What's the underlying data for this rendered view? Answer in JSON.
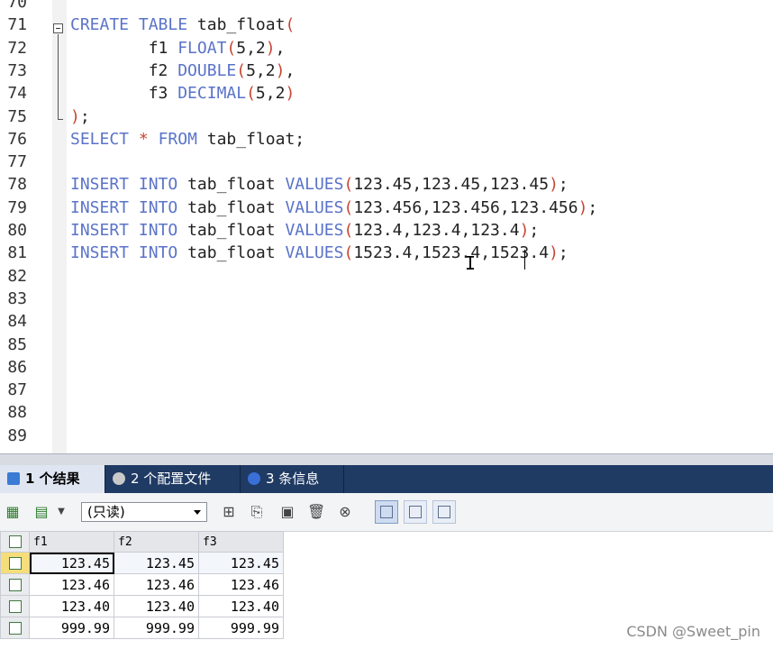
{
  "editor": {
    "lines": [
      {
        "n": "70",
        "code": []
      },
      {
        "n": "71",
        "code": [
          [
            "kw",
            "CREATE"
          ],
          [
            "t",
            " "
          ],
          [
            "kw",
            "TABLE"
          ],
          [
            "t",
            " tab_float"
          ],
          [
            "par",
            "("
          ]
        ]
      },
      {
        "n": "72",
        "code": [
          [
            "t",
            "        f1 "
          ],
          [
            "kw",
            "FLOAT"
          ],
          [
            "par",
            "("
          ],
          [
            "t",
            "5,2"
          ],
          [
            "par",
            ")"
          ],
          [
            "t",
            ","
          ]
        ]
      },
      {
        "n": "73",
        "code": [
          [
            "t",
            "        f2 "
          ],
          [
            "kw",
            "DOUBLE"
          ],
          [
            "par",
            "("
          ],
          [
            "t",
            "5,2"
          ],
          [
            "par",
            ")"
          ],
          [
            "t",
            ","
          ]
        ]
      },
      {
        "n": "74",
        "code": [
          [
            "t",
            "        f3 "
          ],
          [
            "kw",
            "DECIMAL"
          ],
          [
            "par",
            "("
          ],
          [
            "t",
            "5,2"
          ],
          [
            "par",
            ")"
          ]
        ]
      },
      {
        "n": "75",
        "code": [
          [
            "par",
            ")"
          ],
          [
            "t",
            ";"
          ]
        ]
      },
      {
        "n": "76",
        "code": [
          [
            "kw",
            "SELECT"
          ],
          [
            "t",
            " "
          ],
          [
            "par",
            "*"
          ],
          [
            "t",
            " "
          ],
          [
            "kw",
            "FROM"
          ],
          [
            "t",
            " tab_float;"
          ]
        ]
      },
      {
        "n": "77",
        "code": []
      },
      {
        "n": "78",
        "code": [
          [
            "kw",
            "INSERT"
          ],
          [
            "t",
            " "
          ],
          [
            "kw",
            "INTO"
          ],
          [
            "t",
            " tab_float "
          ],
          [
            "kw",
            "VALUES"
          ],
          [
            "par",
            "("
          ],
          [
            "t",
            "123.45,123.45,123.45"
          ],
          [
            "par",
            ")"
          ],
          [
            "t",
            ";"
          ]
        ]
      },
      {
        "n": "79",
        "code": [
          [
            "kw",
            "INSERT"
          ],
          [
            "t",
            " "
          ],
          [
            "kw",
            "INTO"
          ],
          [
            "t",
            " tab_float "
          ],
          [
            "kw",
            "VALUES"
          ],
          [
            "par",
            "("
          ],
          [
            "t",
            "123.456,123.456,123.456"
          ],
          [
            "par",
            ")"
          ],
          [
            "t",
            ";"
          ]
        ]
      },
      {
        "n": "80",
        "code": [
          [
            "kw",
            "INSERT"
          ],
          [
            "t",
            " "
          ],
          [
            "kw",
            "INTO"
          ],
          [
            "t",
            " tab_float "
          ],
          [
            "kw",
            "VALUES"
          ],
          [
            "par",
            "("
          ],
          [
            "t",
            "123.4,123.4,123.4"
          ],
          [
            "par",
            ")"
          ],
          [
            "t",
            ";"
          ]
        ]
      },
      {
        "n": "81",
        "code": [
          [
            "kw",
            "INSERT"
          ],
          [
            "t",
            " "
          ],
          [
            "kw",
            "INTO"
          ],
          [
            "t",
            " tab_float "
          ],
          [
            "kw",
            "VALUES"
          ],
          [
            "par",
            "("
          ],
          [
            "t",
            "1523.4,1523.4,1523.4"
          ],
          [
            "par",
            ")"
          ],
          [
            "t",
            ";"
          ]
        ]
      },
      {
        "n": "82",
        "code": []
      },
      {
        "n": "83",
        "code": []
      },
      {
        "n": "84",
        "code": []
      },
      {
        "n": "85",
        "code": []
      },
      {
        "n": "86",
        "code": []
      },
      {
        "n": "87",
        "code": []
      },
      {
        "n": "88",
        "code": []
      },
      {
        "n": "89",
        "code": []
      }
    ]
  },
  "result_tabs": [
    {
      "label": "1 个结果",
      "icon": "result-grid-icon",
      "active": true
    },
    {
      "label": "2 个配置文件",
      "icon": "profile-icon",
      "active": false
    },
    {
      "label": "3 条信息",
      "icon": "info-icon",
      "active": false
    }
  ],
  "toolbar": {
    "mode_select": "(只读)"
  },
  "grid": {
    "columns": [
      "f1",
      "f2",
      "f3"
    ],
    "rows": [
      [
        "123.45",
        "123.45",
        "123.45"
      ],
      [
        "123.46",
        "123.46",
        "123.46"
      ],
      [
        "123.40",
        "123.40",
        "123.40"
      ],
      [
        "999.99",
        "999.99",
        "999.99"
      ]
    ]
  },
  "watermark": "CSDN @Sweet_pin",
  "colors": {
    "keyword": "#5a73c9",
    "paren": "#c64532",
    "tabbar": "#1f3a63"
  }
}
